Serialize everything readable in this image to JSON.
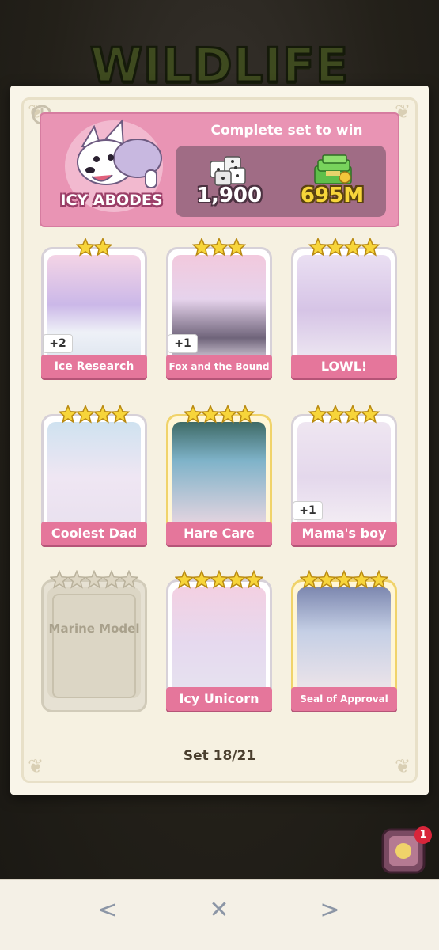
{
  "album": {
    "title": "WILDLIFE"
  },
  "set": {
    "name": "ICY ABODES",
    "reward_title": "Complete set to win",
    "reward_dice": "1,900",
    "reward_cash": "695M",
    "progress": "Set 18/21"
  },
  "stickers": [
    {
      "name": "Ice Research",
      "stars": 2,
      "owned": true,
      "duplicates": "+2",
      "gold": false
    },
    {
      "name": "Fox and the Bound",
      "stars": 3,
      "owned": true,
      "duplicates": "+1",
      "gold": false
    },
    {
      "name": "LOWL!",
      "stars": 4,
      "owned": true,
      "duplicates": "",
      "gold": false
    },
    {
      "name": "Coolest Dad",
      "stars": 4,
      "owned": true,
      "duplicates": "",
      "gold": false
    },
    {
      "name": "Hare Care",
      "stars": 4,
      "owned": true,
      "duplicates": "",
      "gold": true
    },
    {
      "name": "Mama's boy",
      "stars": 4,
      "owned": true,
      "duplicates": "+1",
      "gold": false
    },
    {
      "name": "Marine Model",
      "stars": 5,
      "owned": false,
      "duplicates": "",
      "gold": false
    },
    {
      "name": "Icy Unicorn",
      "stars": 5,
      "owned": true,
      "duplicates": "",
      "gold": false
    },
    {
      "name": "Seal of Approval",
      "stars": 5,
      "owned": true,
      "duplicates": "",
      "gold": true
    }
  ],
  "nav": {
    "prev": "<",
    "close": "✕",
    "next": ">",
    "notification_count": "1"
  },
  "colors": {
    "banner": "#e994b4",
    "label": "#e5769b",
    "star": "#f7d53a"
  },
  "icons": [
    "history-icon",
    "dice-icon",
    "cash-icon",
    "star-icon",
    "album-box-icon"
  ]
}
